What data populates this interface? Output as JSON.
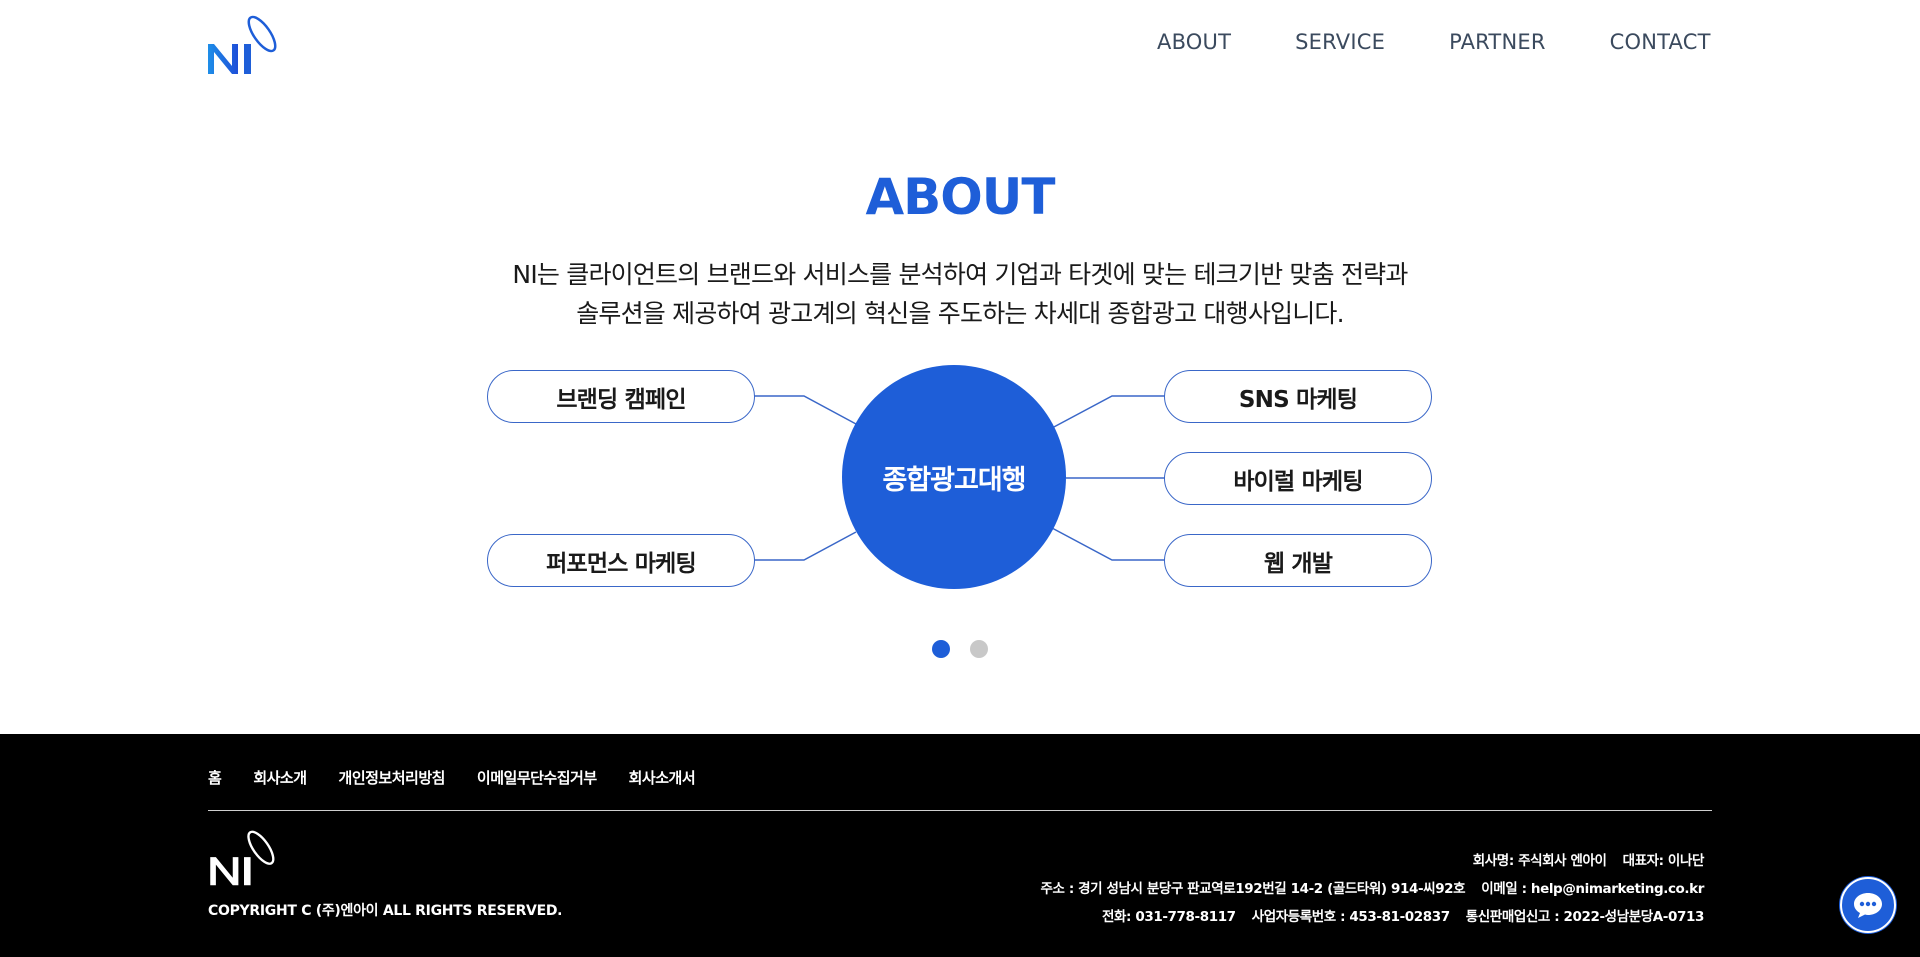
{
  "header": {
    "logo_text": "NI",
    "nav": [
      "ABOUT",
      "SERVICE",
      "PARTNER",
      "CONTACT"
    ]
  },
  "about": {
    "title": "ABOUT",
    "description_line1": "NI는 클라이언트의 브랜드와 서비스를 분석하여 기업과 타겟에 맞는 테크기반 맞춤 전략과",
    "description_line2": "솔루션을 제공하여 광고계의 혁신을 주도하는 차세대 종합광고 대행사입니다.",
    "center_label": "종합광고대행",
    "left_items": [
      "브랜딩 캠페인",
      "퍼포먼스 마케팅"
    ],
    "right_items": [
      "SNS 마케팅",
      "바이럴 마케팅",
      "웹 개발"
    ],
    "slider": {
      "count": 2,
      "active_index": 0
    }
  },
  "footer": {
    "links": [
      "홈",
      "회사소개",
      "개인정보처리방침",
      "이메일무단수집거부",
      "회사소개서"
    ],
    "copyright": "COPYRIGHT C (주)엔아이 ALL RIGHTS RESERVED.",
    "company_name": "회사명: 주식회사 엔아이",
    "ceo": "대표자: 이나단",
    "address": "주소 : 경기 성남시 분당구 판교역로192번길 14-2 (골드타워) 914-씨92호",
    "email": "이메일 : help@nimarketing.co.kr",
    "phone": "전화: 031-778-8117",
    "business_reg": "사업자등록번호 : 453-81-02837",
    "mail_order": "통신판매업신고 : 2022-성남분당A-0713"
  },
  "colors": {
    "brand_blue": "#1e5ed8",
    "nav_text": "#3b4a5e",
    "footer_bg": "#000000"
  },
  "icons": {
    "chat": "chat-bubble-icon"
  }
}
